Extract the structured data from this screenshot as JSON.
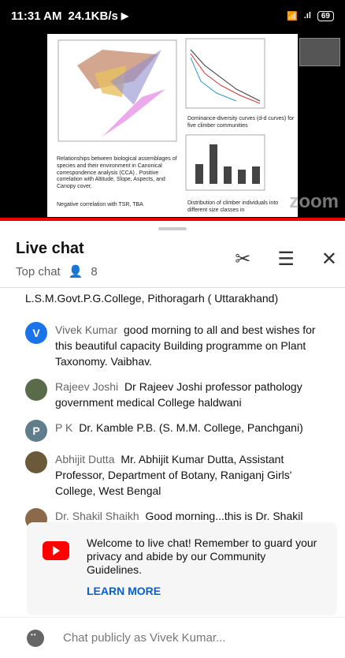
{
  "status": {
    "time": "11:31 AM",
    "speed": "24.1KB/s",
    "battery": "69"
  },
  "slide": {
    "left_caption": "Relationships between biological assemblages of species and their environment in Canonical correspondence analysis (CCA) . Positive correlation with Altitude, Slope, Aspects, and Canopy cover,",
    "left_caption2": "Negative correlation with TSR, TBA",
    "right_caption": "Dominance-diversity curves (d-d curves) for five climber communities",
    "right_caption2": "Distribution of climber individuals into different size classes in",
    "watermark": "zoom"
  },
  "chat": {
    "title": "Live chat",
    "subtitle": "Top chat",
    "viewer_count": "8",
    "messages": [
      {
        "author": "",
        "text": "L.S.M.Govt.P.G.College, Pithoragarh ( Uttarakhand)",
        "avatar": "",
        "color": "#fff"
      },
      {
        "author": "Vivek Kumar",
        "text": "good morning to all and best wishes for this beautiful capacity Building programme on Plant Taxonomy. Vaibhav.",
        "avatar": "V",
        "color": "#1a73e8"
      },
      {
        "author": "Rajeev Joshi",
        "text": "Dr Rajeev Joshi professor pathology government medical College haldwani",
        "avatar": "",
        "color": "#5a6b4a"
      },
      {
        "author": "P K",
        "text": "Dr. Kamble P.B. (S. M.M. College, Panchgani)",
        "avatar": "P",
        "color": "#607d8b"
      },
      {
        "author": "Abhijit Dutta",
        "text": "Mr. Abhijit Kumar Dutta, Assistant Professor, Department of Botany, Raniganj Girls' College, West Bengal",
        "avatar": "",
        "color": "#6b5a3a"
      },
      {
        "author": "Dr. Shakil Shaikh",
        "text": "Good morning...this is Dr. Shakil",
        "avatar": "",
        "color": "#8a6a4a"
      }
    ],
    "welcome_text": "Welcome to live chat! Remember to guard your privacy and abide by our Community Guidelines.",
    "learn_more": "LEARN MORE",
    "input_placeholder": "Chat publicly as Vivek Kumar..."
  }
}
